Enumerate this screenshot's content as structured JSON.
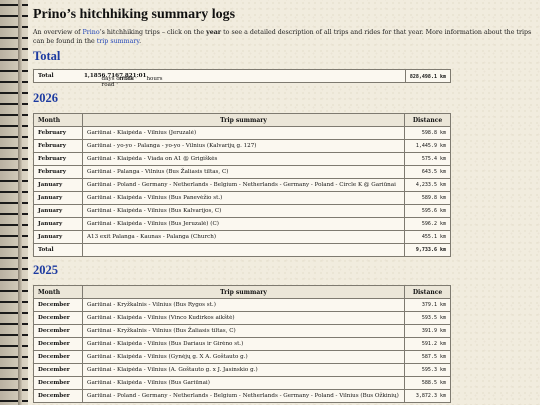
{
  "title": "Prino’s hitchhiking summary logs",
  "intro": {
    "p1": "An overview of ",
    "link1": "Prino",
    "p2": "’s hitchhiking trips – click on the ",
    "bold": "year",
    "p3": " to see a detailed description of all trips and rides for that year. More information about the trips can be found in the ",
    "link2": "trip summary",
    "p4": "."
  },
  "total_section": {
    "heading": "Total",
    "label": "Total",
    "summary_days": "1,185",
    "summary_rest": " days on the road · ",
    "rides": "6,716",
    "rides_text": " rides · ",
    "hours": "7,821:01",
    "hours_text": " hours",
    "distance": "828,498.1 km"
  },
  "columns": {
    "month": "Month",
    "summary": "Trip summary",
    "distance": "Distance"
  },
  "year2026": {
    "heading": "2026",
    "rows": [
      {
        "m": "February",
        "s": "Gariūnai - Klaipėda - Vilnius (Jeruzalė)",
        "d": "598.8 km"
      },
      {
        "m": "February",
        "s": "Gariūnai - yo-yo - Palanga - yo-yo - Vilnius (Kalvarijų g. 127)",
        "d": "1,445.9 km"
      },
      {
        "m": "February",
        "s": "Gariūnai - Klaipėda - Viada on A1 @ Grigiškės",
        "d": "575.4 km"
      },
      {
        "m": "February",
        "s": "Gariūnai - Palanga - Vilnius (Bus Žaliasis tiltas, C)",
        "d": "643.5 km"
      },
      {
        "m": "January",
        "s": "Gariūnai - Poland - Germany - Netherlands - Belgium - Netherlands - Germany - Poland - Circle K @ Gariūnai",
        "d": "4,233.5 km"
      },
      {
        "m": "January",
        "s": "Gariūnai - Klaipėda - Vilnius (Bus Panevėžio st.)",
        "d": "589.8 km"
      },
      {
        "m": "January",
        "s": "Gariūnai - Klaipėda - Vilnius (Bus Kalvarijos, C)",
        "d": "595.6 km"
      },
      {
        "m": "January",
        "s": "Gariūnai - Klaipėda - Vilnius (Bus Jeruzalė) (C)",
        "d": "596.2 km"
      },
      {
        "m": "January",
        "s": "A13 exit Palanga - Kaunas - Palanga (Church)",
        "d": "455.1 km"
      }
    ],
    "total_label": "Total",
    "total": "9,733.6 km"
  },
  "year2025": {
    "heading": "2025",
    "rows": [
      {
        "m": "December",
        "s": "Gariūnai - Kryžkalnis - Vilnius (Bus Rygos st.)",
        "d": "379.1 km"
      },
      {
        "m": "December",
        "s": "Gariūnai - Klaipėda - Vilnius (Vinco Kudirkos aikštė)",
        "d": "593.5 km"
      },
      {
        "m": "December",
        "s": "Gariūnai - Kryžkalnis - Vilnius (Bus Žaliasis tiltas, C)",
        "d": "391.9 km"
      },
      {
        "m": "December",
        "s": "Gariūnai - Klaipėda - Vilnius (Bus Dariaus ir Girėno st.)",
        "d": "591.2 km"
      },
      {
        "m": "December",
        "s": "Gariūnai - Klaipėda - Vilnius (Gynėjų g. X A. Goštauto g.)",
        "d": "587.5 km"
      },
      {
        "m": "December",
        "s": "Gariūnai - Klaipėda - Vilnius (A. Goštauto g. x J. Jasinskio g.)",
        "d": "595.3 km"
      },
      {
        "m": "December",
        "s": "Gariūnai - Klaipėda - Vilnius (Bus Gariūnai)",
        "d": "588.5 km"
      },
      {
        "m": "December",
        "s": "Gariūnai - Poland - Germany - Netherlands - Belgium - Netherlands - Germany - Poland - Vilnius (Bus Ožkinių)",
        "d": "3,872.3 km"
      }
    ]
  }
}
